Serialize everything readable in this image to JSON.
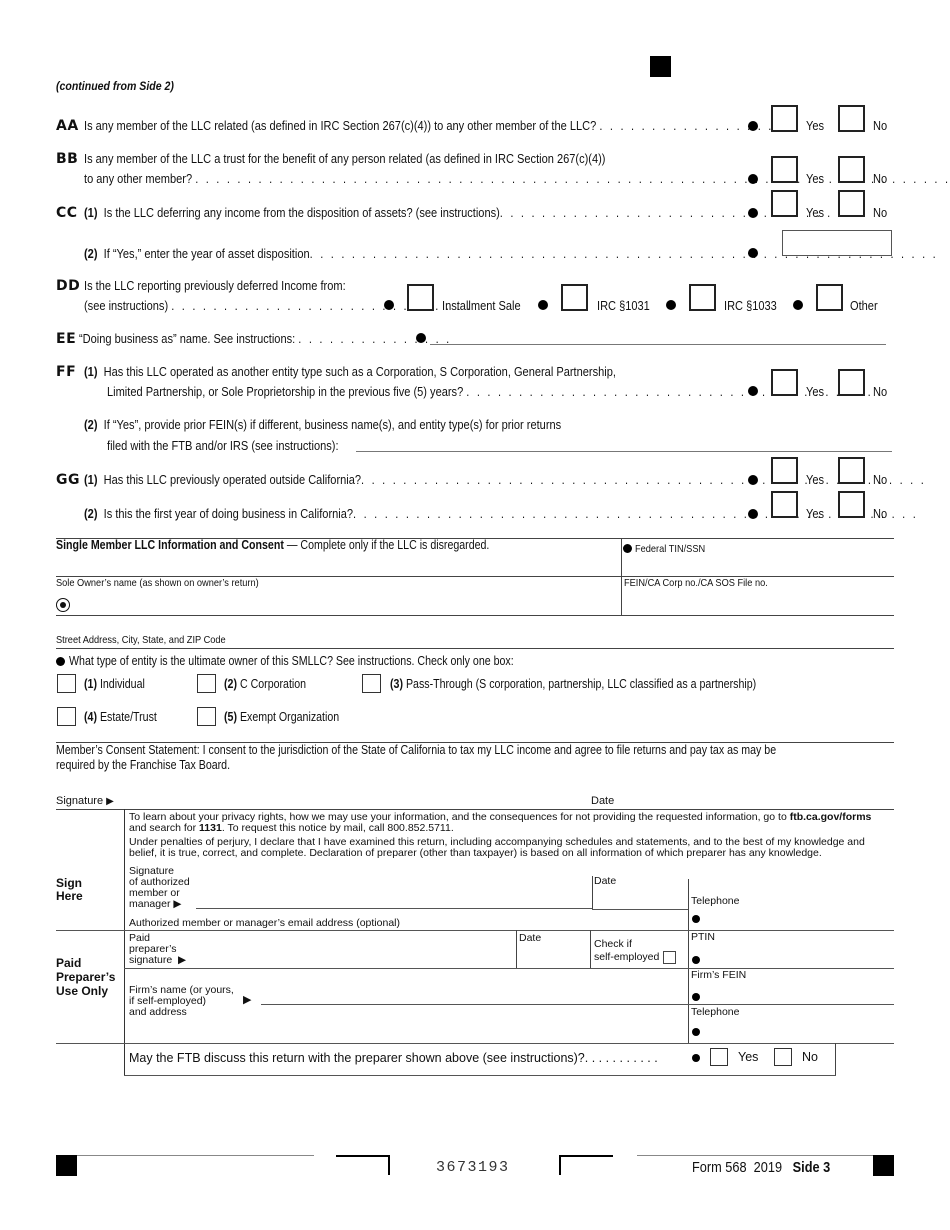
{
  "header": {
    "continued": "(continued from Side 2)"
  },
  "questions": {
    "AA": {
      "letter": "AA",
      "text": "Is any member of the LLC related (as defined in IRC Section 267(c)(4)) to any other member of the LLC?",
      "dots": ". . . . . . . . . . . . . . . . .",
      "yes": "Yes",
      "no": "No"
    },
    "BB": {
      "letter": "BB",
      "text1": "Is any member of the LLC a trust for the benefit of any person related (as defined in IRC Section 267(c)(4))",
      "text2": "to any other member?",
      "dots": ". . . . . . . . . . . . . . . . . . . . . . . . . . . . . . . . . . . . . . . . . . . . . . . . . . . . . . . . . . . . . . . . . . . . . . . .",
      "yes": "Yes",
      "no": "No"
    },
    "CC": {
      "letter": "CC",
      "p1_num": "(1)",
      "p1_text": "Is the LLC deferring any income from the disposition of assets? (see instructions)",
      "p1_dots": ". . . . . . . . . . . . . . . . . . . . . . . . . . . . . . . . .",
      "p2_num": "(2)",
      "p2_text": "If “Yes,” enter the year of asset disposition",
      "p2_dots": ". . . . . . . . . . . . . . . . . . . . . . . . . . . . . . . . . . . . . . . . . . . . . . . . . . . . . . . . . . . .",
      "yes": "Yes",
      "no": "No",
      "year_value": ""
    },
    "DD": {
      "letter": "DD",
      "text1": "Is the LLC reporting previously deferred Income from:",
      "text2": "(see instructions)",
      "dots": ". . . . . . . . . . . . . . . . . . . . . . . . . . . . . .",
      "options": [
        "Installment Sale",
        "IRC §1031",
        "IRC §1033",
        "Other"
      ]
    },
    "EE": {
      "letter": "EE",
      "text": "“Doing business as” name. See instructions:",
      "dots": ". . . . . . . . . . . . . . .",
      "value": ""
    },
    "FF": {
      "letter": "FF",
      "p1_num": "(1)",
      "p1_text1": "Has this LLC operated as another entity type such as a Corporation, S Corporation, General Partnership,",
      "p1_text2": "Limited Partnership, or Sole Proprietorship in the previous five (5) years?",
      "p1_dots": ". . . . . . . . . . . . . . . . . . . . . . . . . . . . . . . . . . . . . . . .",
      "p2_num": "(2)",
      "p2_text1": "If “Yes”, provide prior FEIN(s) if different, business name(s), and entity type(s) for prior returns",
      "p2_text2": "filed with the FTB and/or IRS (see instructions):",
      "p2_value": "",
      "yes": "Yes",
      "no": "No"
    },
    "GG": {
      "letter": "GG",
      "p1_num": "(1)",
      "p1_text": "Has this LLC previously operated outside California?",
      "p1_dots": ". . . . . . . . . . . . . . . . . . . . . . . . . . . . . . . . . . . . . . . . . . . . . . . . . . . . . .",
      "p2_num": "(2)",
      "p2_text": "Is this the first year of doing business in California?",
      "p2_dots": ". . . . . . . . . . . . . . . . . . . . . . . . . . . . . . . . . . . . . . . . . . . . . . . . . . . . . .",
      "yes": "Yes",
      "no": "No"
    }
  },
  "smllc": {
    "title_bold": "Single Member LLC Information and Consent",
    "title_rest": " — Complete only if the LLC is disregarded.",
    "federal_tin_label": "Federal TIN/SSN",
    "owner_name_label": "Sole Owner’s name (as shown on owner’s return)",
    "fein_label": "FEIN/CA Corp no./CA SOS File no.",
    "address_label": "Street Address, City, State, and ZIP Code",
    "entity_question": "What type of entity is the ultimate owner of this SMLLC? See instructions. Check only one box:",
    "entity_options": [
      {
        "num": "(1)",
        "label": "Individual"
      },
      {
        "num": "(2)",
        "label": "C Corporation"
      },
      {
        "num": "(3)",
        "label": "Pass-Through (S corporation, partnership, LLC classified as a partnership)"
      },
      {
        "num": "(4)",
        "label": "Estate/Trust"
      },
      {
        "num": "(5)",
        "label": "Exempt Organization"
      }
    ],
    "consent_line1": "Member’s Consent Statement: I consent to the jurisdiction of the State of California to tax my LLC income and agree to file returns and pay tax as may be",
    "consent_line2": "required by the Franchise Tax Board.",
    "signature_label": "Signature",
    "date_label": "Date"
  },
  "sign": {
    "privacy_1a": "To learn about your privacy rights, how we may use your information, and the consequences for not providing the requested information, go to ",
    "privacy_1b": "ftb.ca.gov/forms",
    "privacy_2a": "and search for ",
    "privacy_2b": "1131",
    "privacy_2c": ". To request this notice by mail, call 800.852.5711.",
    "perjury_1": "Under penalties of perjury, I declare that I have examined this return, including accompanying schedules and statements, and to the best of my knowledge and",
    "perjury_2": "belief, it is true, correct, and complete. Declaration of preparer (other than taxpayer) is based on all information of which preparer has any knowledge.",
    "sign_here_1": "Sign",
    "sign_here_2": "Here",
    "sig_label": [
      "Signature",
      "of authorized",
      "member or",
      "manager"
    ],
    "date_label": "Date",
    "telephone_label": "Telephone",
    "email_label": "Authorized member or manager’s email address (optional)"
  },
  "preparer": {
    "section_1": "Paid",
    "section_2": "Preparer’s",
    "section_3": "Use Only",
    "sig_label": [
      "Paid",
      "preparer’s",
      "signature"
    ],
    "date_label": "Date",
    "self_employed_1": "Check if",
    "self_employed_2": "self-employed",
    "ptin_label": "PTIN",
    "firm_label": [
      "Firm’s name (or yours,",
      "if self-employed)",
      "and address"
    ],
    "firm_fein_label": "Firm’s FEIN",
    "telephone_label": "Telephone",
    "discuss_text": "May the FTB discuss this return with the preparer shown above (see instructions)?",
    "discuss_dots": ". . . . . . . . . . .",
    "yes": "Yes",
    "no": "No"
  },
  "footer": {
    "barcode_number": "3673193",
    "form": "Form 568",
    "year": "2019",
    "side": "Side 3"
  }
}
